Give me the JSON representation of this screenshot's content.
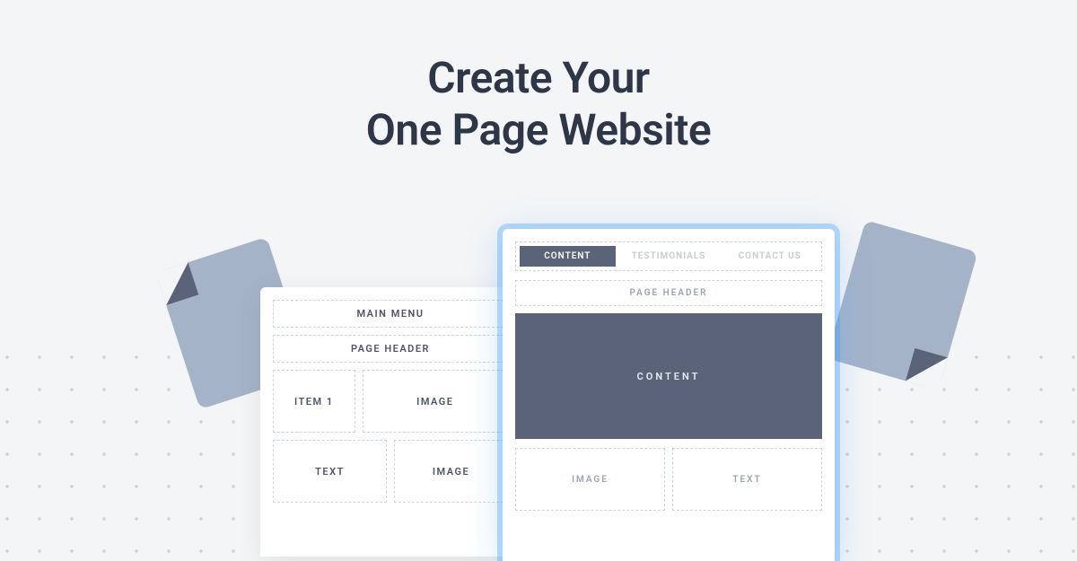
{
  "heading_line1": "Create Your",
  "heading_line2": "One Page Website",
  "back_mockup": {
    "main_menu": "MAIN MENU",
    "page_header": "PAGE HEADER",
    "item1": "ITEM 1",
    "image1": "IMAGE",
    "text": "TEXT",
    "image2": "IMAGE"
  },
  "front_mockup": {
    "tabs": {
      "content": "CONTENT",
      "testimonials": "TESTIMONIALS",
      "contact": "CONTACT US"
    },
    "page_header": "PAGE HEADER",
    "content": "CONTENT",
    "image": "IMAGE",
    "text": "TEXT"
  }
}
